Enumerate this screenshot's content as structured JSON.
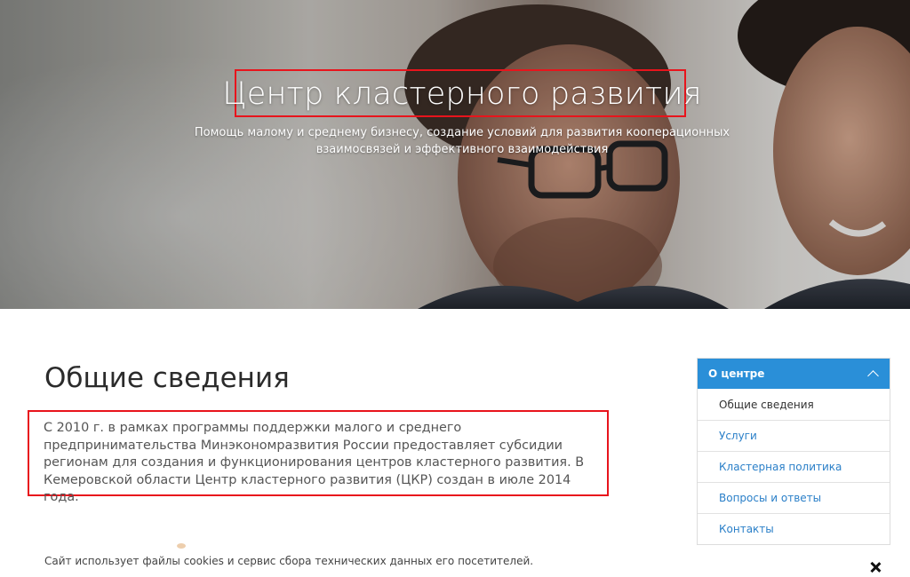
{
  "hero": {
    "title": "Центр кластерного развития",
    "subtitle": "Помощь малому и среднему бизнесу, создание условий для развития кооперационных взаимосвязей и эффективного взаимодействия"
  },
  "main": {
    "heading": "Общие сведения",
    "paragraph": "С 2010 г. в рамках программы поддержки малого и среднего предпринимательства Минэкономразвития России предоставляет субсидии регионам для создания и функционирования центров кластерного развития. В Кемеровской области Центр кластерного развития (ЦКР) создан в июле 2014 года."
  },
  "sidebar": {
    "header": "О центре",
    "items": [
      {
        "label": "Общие сведения"
      },
      {
        "label": "Услуги"
      },
      {
        "label": "Кластерная политика"
      },
      {
        "label": "Вопросы и ответы"
      },
      {
        "label": "Контакты"
      }
    ]
  },
  "cookie": {
    "text": "Сайт использует файлы cookies и сервис сбора технических данных его посетителей."
  },
  "colors": {
    "accent": "#2a8fd8",
    "highlight_border": "#e8141c",
    "link": "#2a7fc8"
  }
}
